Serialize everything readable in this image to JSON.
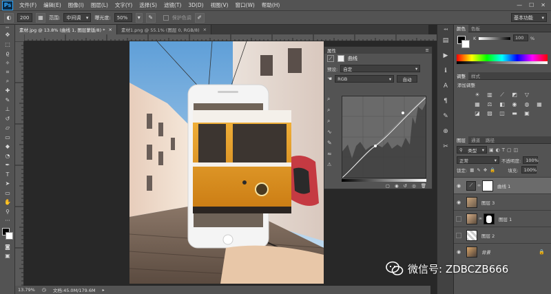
{
  "app": {
    "logo": "Ps",
    "menus": [
      "文件(F)",
      "编辑(E)",
      "图像(I)",
      "图层(L)",
      "文字(Y)",
      "选择(S)",
      "滤镜(T)",
      "3D(D)",
      "视图(V)",
      "窗口(W)",
      "帮助(H)"
    ],
    "window_controls": [
      "—",
      "☐",
      "✕"
    ]
  },
  "options_bar": {
    "brush_size": "200",
    "range_label": "范围:",
    "range_value": "中间调",
    "exposure_label": "曝光度:",
    "exposure_value": "50%",
    "protect_tone_label": "保护色调",
    "workspace": "基本功能"
  },
  "documents": {
    "tabs": [
      {
        "label": "素材.jpg @ 13.8% (曲线 1, 图层蒙版/8) *",
        "close": "×"
      },
      {
        "label": "素材1.png @ 55.1% (图层 0, RGB/8)",
        "close": "×"
      }
    ]
  },
  "status": {
    "zoom": "13.79%",
    "doc_size": "文档:45.0M/179.6M"
  },
  "properties": {
    "tab": "属性",
    "title": "曲线",
    "preset_label": "预设:",
    "preset_value": "自定",
    "channel_value": "RGB",
    "auto_button": "自动"
  },
  "color_panel": {
    "tabs": [
      "颜色",
      "色板"
    ],
    "k_label": "K",
    "k_value": "100",
    "percent": "%"
  },
  "adjustments_panel": {
    "tabs": [
      "调整",
      "样式"
    ],
    "subtitle": "添加调整"
  },
  "layers_panel": {
    "tabs": [
      "图层",
      "通道",
      "路径"
    ],
    "kind_filter": "类型",
    "blend_mode": "正常",
    "opacity_label": "不透明度:",
    "opacity_value": "100%",
    "lock_label": "锁定:",
    "fill_label": "填充:",
    "fill_value": "100%",
    "layers": [
      {
        "name": "曲线 1",
        "visible": true,
        "selected": true
      },
      {
        "name": "图层 3",
        "visible": true,
        "selected": false
      },
      {
        "name": "图层 1",
        "visible": false,
        "selected": false
      },
      {
        "name": "图层 2",
        "visible": false,
        "selected": false
      },
      {
        "name": "背景",
        "visible": true,
        "selected": false
      }
    ]
  },
  "watermark": {
    "text": "微信号: ZDBCZB666"
  },
  "colors": {
    "accent": "#31a8ff",
    "tram_yellow": "#e29a1f",
    "panel": "#535353"
  }
}
